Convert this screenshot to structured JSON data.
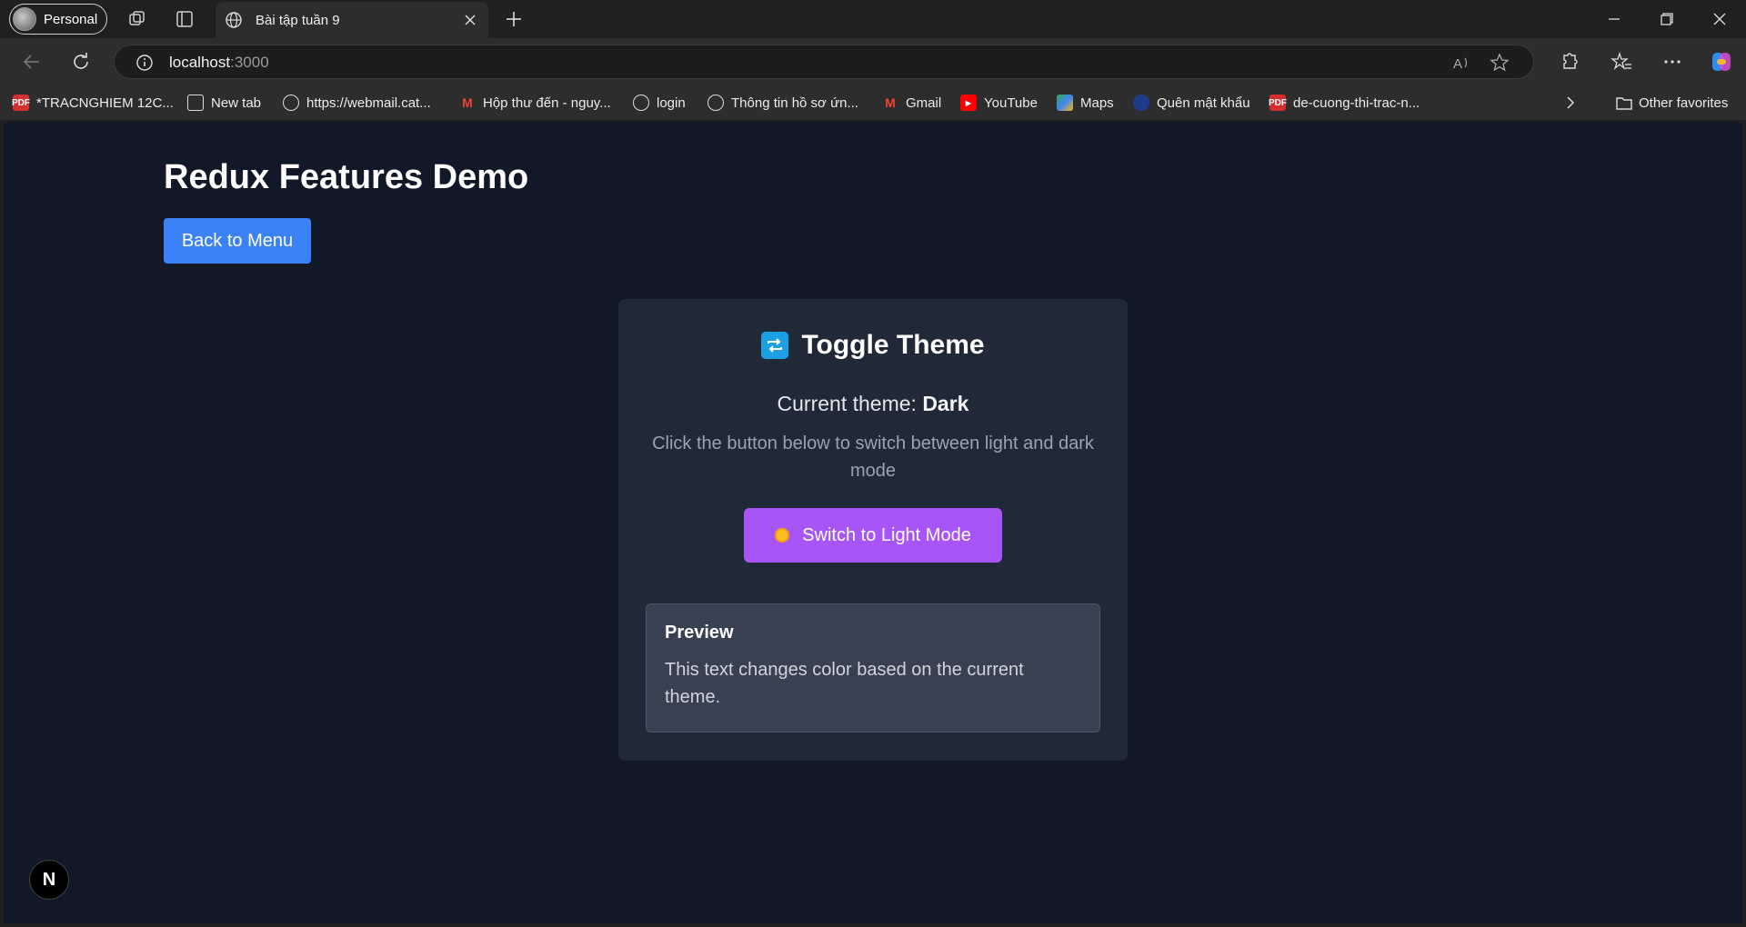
{
  "browser": {
    "profile_label": "Personal",
    "tab_title": "Bài tập tuần 9",
    "url_host": "localhost",
    "url_port": ":3000"
  },
  "bookmarks": [
    {
      "label": "*TRACNGHIEM 12C...",
      "icon": "pdf-icon"
    },
    {
      "label": "New tab",
      "icon": "newtab-icon"
    },
    {
      "label": "https://webmail.cat...",
      "icon": "globe-icon"
    },
    {
      "label": "Hộp thư đến - nguy...",
      "icon": "gmail-icon"
    },
    {
      "label": "login",
      "icon": "globe-icon"
    },
    {
      "label": "Thông tin hồ sơ ứn...",
      "icon": "globe-icon"
    },
    {
      "label": "Gmail",
      "icon": "gmail-icon"
    },
    {
      "label": "YouTube",
      "icon": "youtube-icon"
    },
    {
      "label": "Maps",
      "icon": "maps-icon"
    },
    {
      "label": "Quên mật khẩu",
      "icon": "shield-icon"
    },
    {
      "label": "de-cuong-thi-trac-n...",
      "icon": "pdf-icon"
    }
  ],
  "other_favorites": "Other favorites",
  "page": {
    "title": "Redux Features Demo",
    "back_button": "Back to Menu",
    "card": {
      "title": "Toggle Theme",
      "current_prefix": "Current theme:",
      "current_value": "Dark",
      "hint": "Click the button below to switch between light and dark mode",
      "switch_button": "Switch to Light Mode",
      "preview_title": "Preview",
      "preview_text": "This text changes color based on the current theme."
    },
    "badge": "N"
  },
  "colors": {
    "page_bg": "#111827",
    "card_bg": "#1f2937",
    "back_button": "#3b82f6",
    "switch_button": "#a855f7"
  }
}
